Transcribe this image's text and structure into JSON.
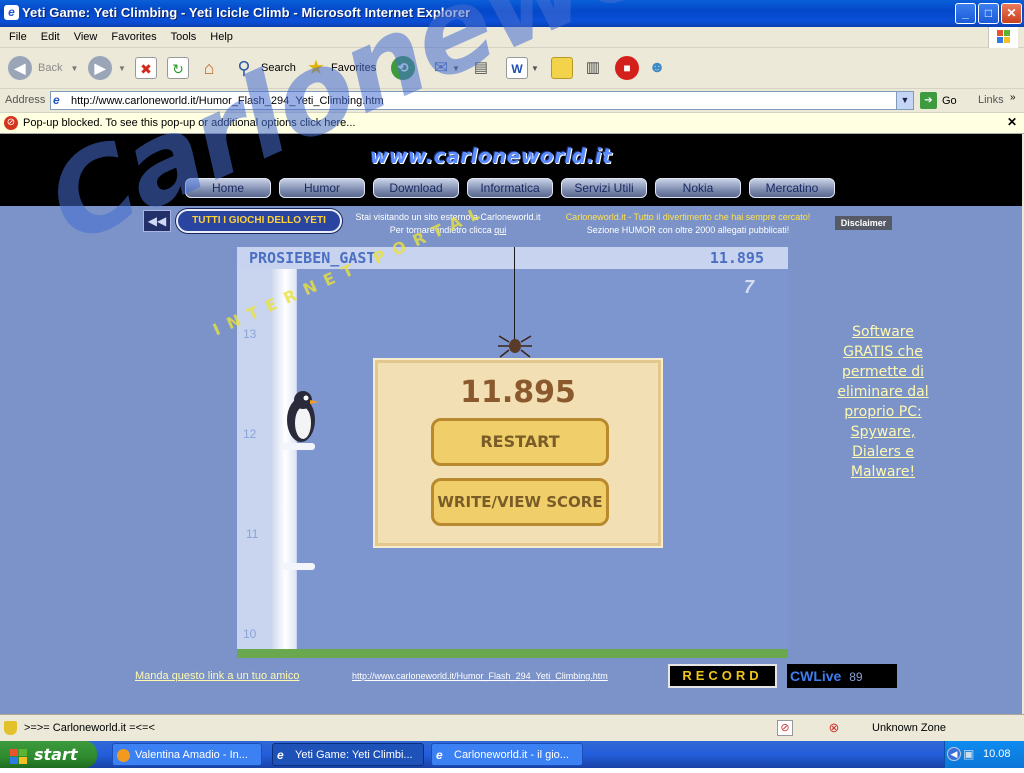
{
  "window": {
    "title": "Yeti Game: Yeti Climbing - Yeti Icicle Climb - Microsoft Internet Explorer",
    "controls": {
      "minimize": "_",
      "maximize": "□",
      "close": "✕"
    }
  },
  "menu": [
    "File",
    "Edit",
    "View",
    "Favorites",
    "Tools",
    "Help"
  ],
  "toolbar": {
    "back": "Back",
    "search": "Search",
    "favorites": "Favorites"
  },
  "address": {
    "label": "Address",
    "url": "http://www.carloneworld.it/Humor_Flash_294_Yeti_Climbing.htm",
    "go": "Go",
    "links": "Links"
  },
  "popup_bar": {
    "text": "Pop-up blocked. To see this pop-up or additional options click here...",
    "close": "✕"
  },
  "site": {
    "logo": "www.carloneworld.it",
    "nav": [
      "Home",
      "Humor",
      "Download",
      "Informatica",
      "Servizi Utili",
      "Nokia",
      "Mercatino"
    ],
    "games_button": "TUTTI I GIOCHI DELLO YETI",
    "external_notice_1": "Stai visitando un sito esterno a Carloneworld.it",
    "external_notice_2": "Per tornare indietro clicca",
    "external_notice_link": "qui",
    "tagline_1": "Carloneworld.it - Tutto il divertimento che hai sempre cercato!",
    "tagline_2": "Sezione HUMOR con oltre 2000 allegati pubblicati!",
    "disclaimer": "Disclaimer",
    "side_ad": [
      "Software",
      "GRATIS che",
      "permette di",
      "eliminare dal",
      "proprio PC:",
      "Spyware,",
      "Dialers e",
      "Malware!"
    ],
    "friend_link": "Manda questo link a un tuo amico",
    "footer_url": "http://www.carloneworld.it/Humor_Flash_294_Yeti_Climbing.htm",
    "record_button": "RECORD",
    "cwlive": "CWLive",
    "cwlive_number": "89",
    "watermark_main": "Carloneworld.it",
    "watermark_sub": "INTERNET PORTAL"
  },
  "game": {
    "player_name": "PROSIEBEN_GAST",
    "header_score": "11.895",
    "final_score": "11.895",
    "restart_button": "RESTART",
    "score_button": "WRITE/VIEW SCORE",
    "height_markers": [
      "13",
      "12",
      "11",
      "10"
    ],
    "tv_logo": "7"
  },
  "status": {
    "text": ">=>= Carloneworld.it =<=<",
    "zone": "Unknown Zone"
  },
  "taskbar": {
    "start": "start",
    "tasks": [
      "Valentina Amadio - In...",
      "Yeti Game: Yeti Climbi...",
      "Carloneworld.it - il gio..."
    ],
    "clock": "10.08"
  }
}
